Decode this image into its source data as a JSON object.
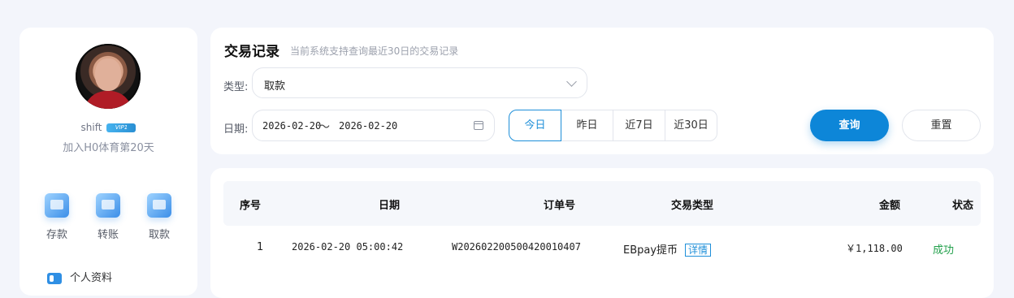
{
  "sidebar": {
    "username": "shift",
    "vip_label": "VIP1",
    "join_text": "加入H0体育第20天",
    "quick_actions": [
      {
        "label": "存款",
        "icon": "deposit-icon"
      },
      {
        "label": "转账",
        "icon": "transfer-icon"
      },
      {
        "label": "取款",
        "icon": "withdraw-icon"
      }
    ],
    "menu": [
      {
        "label": "个人资料",
        "icon": "profile-card-icon"
      }
    ]
  },
  "filter": {
    "title": "交易记录",
    "subtitle": "当前系统支持查询最近30日的交易记录",
    "type_label": "类型:",
    "type_value": "取款",
    "date_label": "日期:",
    "date_from": "2026-02-20",
    "date_separator": "〜",
    "date_to": "2026-02-20",
    "quick_ranges": [
      "今日",
      "昨日",
      "近7日",
      "近30日"
    ],
    "active_range": "今日",
    "query_button": "查询",
    "reset_button": "重置"
  },
  "table": {
    "columns": [
      "序号",
      "日期",
      "订单号",
      "交易类型",
      "金额",
      "状态"
    ],
    "rows": [
      {
        "index": "1",
        "date": "2026-02-20 05:00:42",
        "order_no": "W202602200500420010407",
        "type": "EBpay提币",
        "detail_label": "详情",
        "amount": "￥1,118.00",
        "status": "成功"
      }
    ]
  },
  "colors": {
    "accent": "#0d86d8",
    "success": "#23a04c",
    "background": "#f3f5fb"
  }
}
